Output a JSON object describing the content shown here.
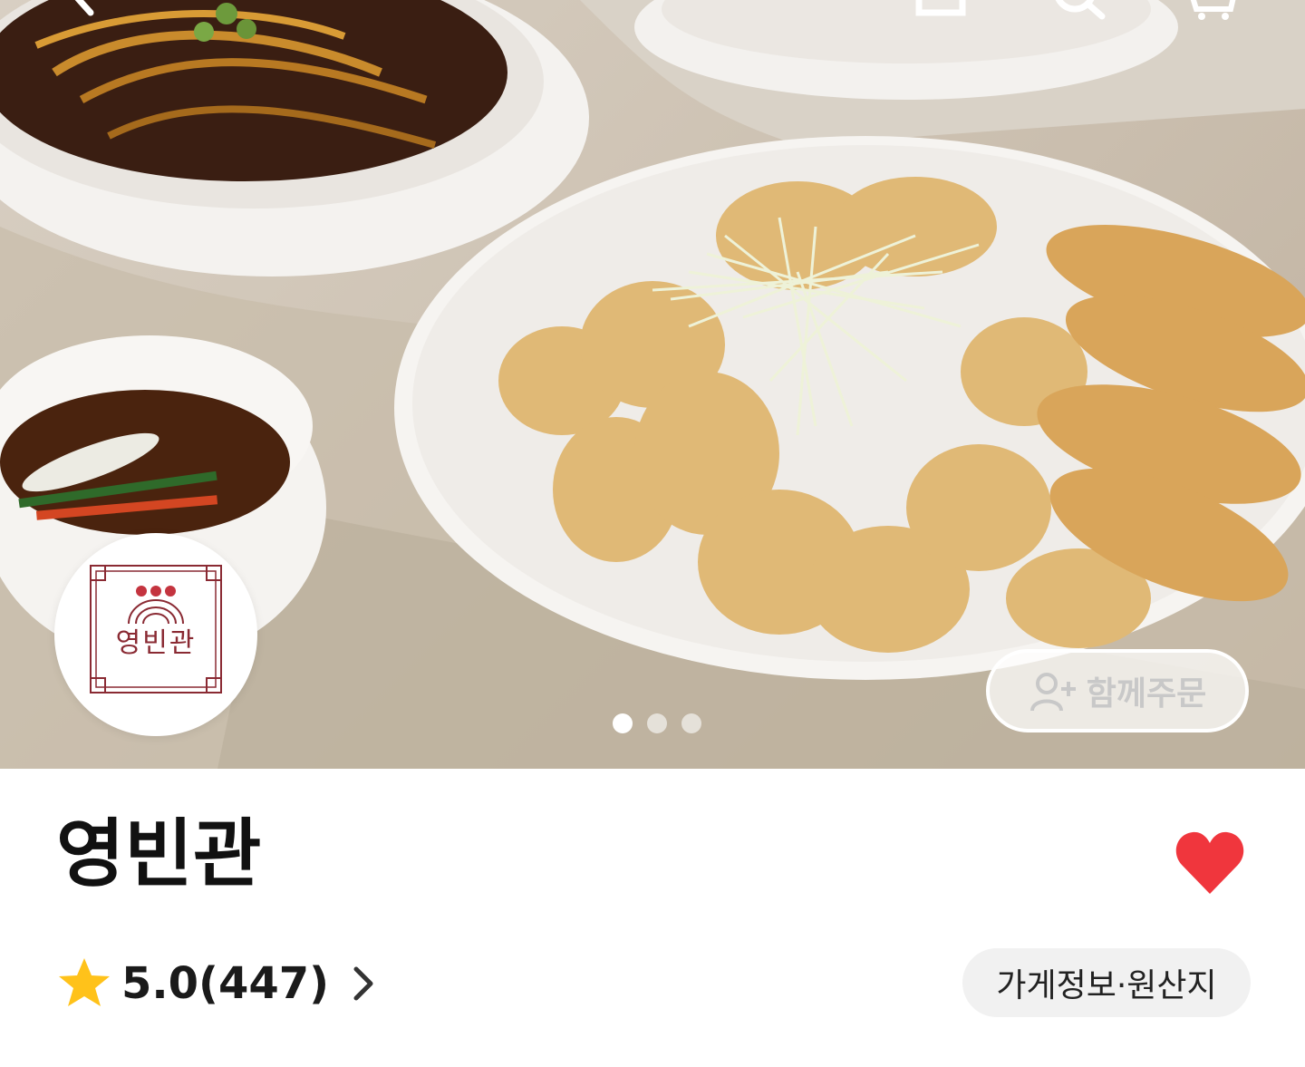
{
  "store": {
    "name": "영빈관",
    "logo_text": "영빈관",
    "rating": "5.0",
    "review_count": "(447)",
    "rating_display": "5.0(447)",
    "info_button": "가게정보·원산지",
    "favorited": true
  },
  "hero": {
    "together_order_label": "함께주문",
    "carousel": {
      "total": 3,
      "active": 1
    }
  },
  "icons": {
    "back": "chevron-left-icon",
    "share": "share-icon",
    "search": "search-icon",
    "cart": "cart-icon",
    "add_person": "add-person-icon",
    "heart": "heart-icon",
    "star": "star-icon",
    "chevron": "chevron-right-icon"
  },
  "colors": {
    "heart": "#f0363d",
    "star": "#ffc21a",
    "logo": "#8a2a33"
  }
}
